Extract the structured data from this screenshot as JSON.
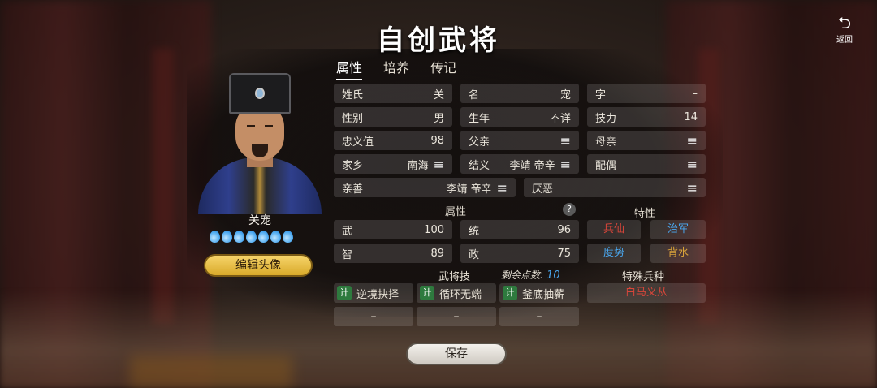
{
  "title": "自创武将",
  "back_label": "返回",
  "tabs": [
    {
      "label": "属性",
      "active": true
    },
    {
      "label": "培养",
      "active": false
    },
    {
      "label": "传记",
      "active": false
    }
  ],
  "hero": {
    "name": "关宠",
    "drop_count": 7,
    "edit_avatar_label": "编辑头像"
  },
  "info": {
    "surname": {
      "label": "姓氏",
      "value": "关"
    },
    "given": {
      "label": "名",
      "value": "宠"
    },
    "courtesy": {
      "label": "字",
      "value": "–"
    },
    "gender": {
      "label": "性别",
      "value": "男"
    },
    "birth": {
      "label": "生年",
      "value": "不详"
    },
    "skill_power": {
      "label": "技力",
      "value": "14"
    },
    "loyalty": {
      "label": "忠义值",
      "value": "98"
    },
    "father": {
      "label": "父亲"
    },
    "mother": {
      "label": "母亲"
    },
    "hometown": {
      "label": "家乡",
      "value": "南海"
    },
    "sworn": {
      "label": "结义",
      "value": "李靖 帝辛"
    },
    "spouse": {
      "label": "配偶"
    },
    "likes": {
      "label": "亲善",
      "value": "李靖 帝辛"
    },
    "dislikes": {
      "label": "厌恶"
    }
  },
  "attributes": {
    "header": "属性",
    "help": "?",
    "items": [
      {
        "label": "武",
        "value": "100"
      },
      {
        "label": "统",
        "value": "96"
      },
      {
        "label": "智",
        "value": "89"
      },
      {
        "label": "政",
        "value": "75"
      }
    ]
  },
  "traits": {
    "header": "特性",
    "items": [
      {
        "label": "兵仙",
        "color": "#d8463a"
      },
      {
        "label": "治军",
        "color": "#4aa8f0"
      },
      {
        "label": "度势",
        "color": "#4aa8f0"
      },
      {
        "label": "背水",
        "color": "#d8a23a"
      }
    ]
  },
  "skills": {
    "header": "武将技",
    "points_label": "剩余点数:",
    "points_value": "10",
    "items": [
      {
        "badge": "计",
        "label": "逆境抉择"
      },
      {
        "badge": "计",
        "label": "循环无端"
      },
      {
        "badge": "计",
        "label": "釜底抽薪"
      }
    ],
    "empty": [
      "–",
      "–",
      "–"
    ]
  },
  "special_troop": {
    "header": "特殊兵种",
    "value": "白马义从"
  },
  "menu_icon": "≡",
  "save_label": "保存"
}
